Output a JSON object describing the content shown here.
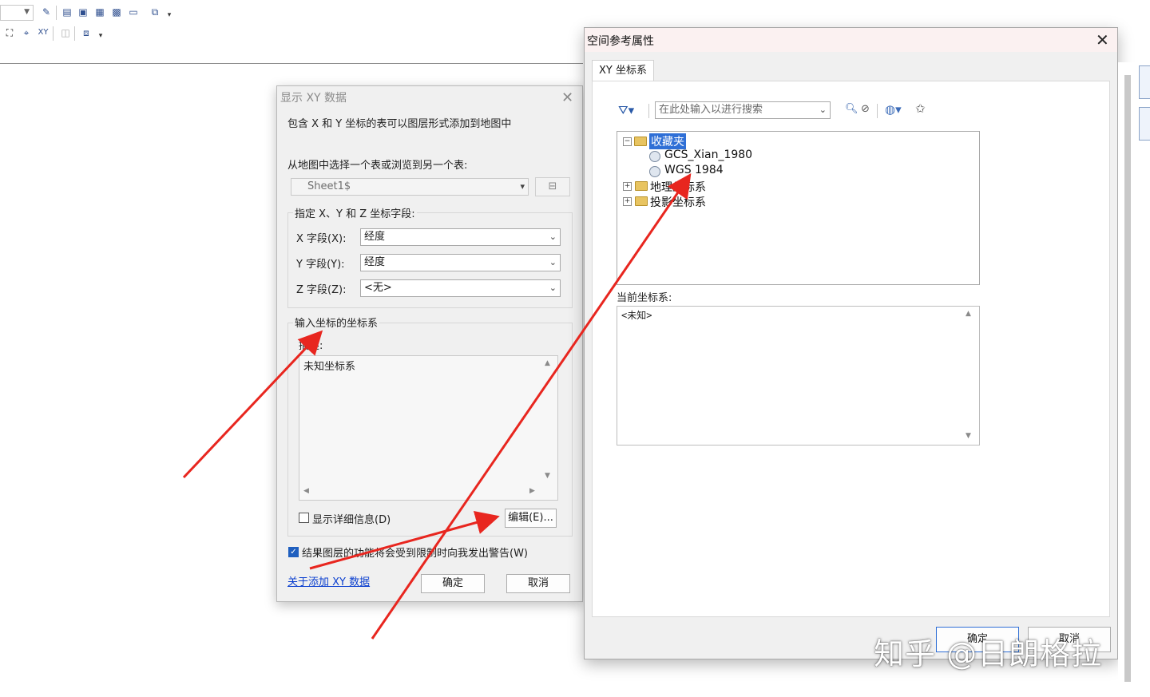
{
  "dialog_xy": {
    "title": "显示 XY 数据",
    "intro": "包含 X 和 Y 坐标的表可以图层形式添加到地图中",
    "choose_table_label": "从地图中选择一个表或浏览到另一个表:",
    "table_value": "Sheet1$",
    "fields_group_label": "指定 X、Y 和 Z 坐标字段:",
    "x_label": "X 字段(X):",
    "x_value": "经度",
    "y_label": "Y 字段(Y):",
    "y_value": "经度",
    "z_label": "Z 字段(Z):",
    "z_value": "<无>",
    "coord_group_label": "输入坐标的坐标系",
    "desc_label": "描述:",
    "desc_value": "未知坐标系",
    "show_details_label": "显示详细信息(D)",
    "edit_button": "编辑(E)...",
    "warn_label": "结果图层的功能将会受到限制时向我发出警告(W)",
    "about_link": "关于添加 XY 数据",
    "ok_button": "确定",
    "cancel_button": "取消"
  },
  "dialog_sr": {
    "title": "空间参考属性",
    "tab_label": "XY 坐标系",
    "search_placeholder": "在此处输入以进行搜索",
    "tree": {
      "favorites": "收藏夹",
      "fav_item1": "GCS_Xian_1980",
      "fav_item2": "WGS 1984",
      "geographic": "地理坐标系",
      "projected": "投影坐标系"
    },
    "current_label": "当前坐标系:",
    "current_value": "<未知>",
    "ok_button": "确定",
    "cancel_button": "取消"
  },
  "watermark": "知乎 @日朗格拉",
  "colors": {
    "annotation_arrow": "#e8261f",
    "selection": "#2f6fd6",
    "link": "#0b3fcf"
  }
}
